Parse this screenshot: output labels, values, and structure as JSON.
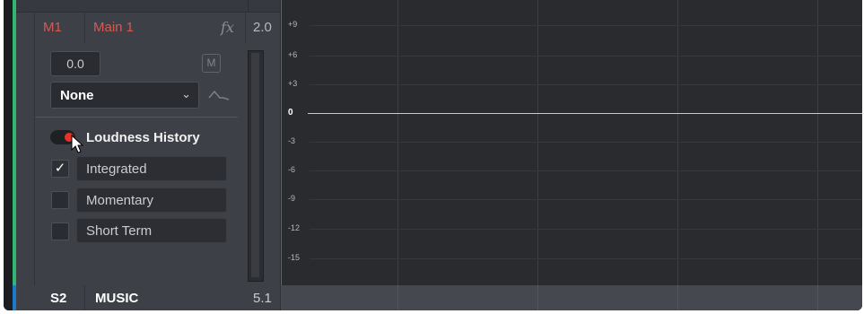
{
  "track": {
    "id": "M1",
    "name": "Main 1",
    "fx_label": "fx",
    "channels": "2.0",
    "volume": "0.0",
    "mute_label": "M",
    "automation_select": "None"
  },
  "loudness": {
    "title": "Loudness History",
    "enabled": true,
    "options": [
      {
        "label": "Integrated",
        "checked": true
      },
      {
        "label": "Momentary",
        "checked": false
      },
      {
        "label": "Short Term",
        "checked": false
      }
    ]
  },
  "graph": {
    "y_ticks": [
      "+9",
      "+6",
      "+3",
      "0",
      "-3",
      "-6",
      "-9",
      "-12",
      "-15"
    ]
  },
  "next_track": {
    "id": "S2",
    "name": "MUSIC",
    "channels": "5.1"
  },
  "colors": {
    "accent_red": "#d65a52",
    "track_green": "#33b573",
    "track_blue": "#1f78c8"
  }
}
